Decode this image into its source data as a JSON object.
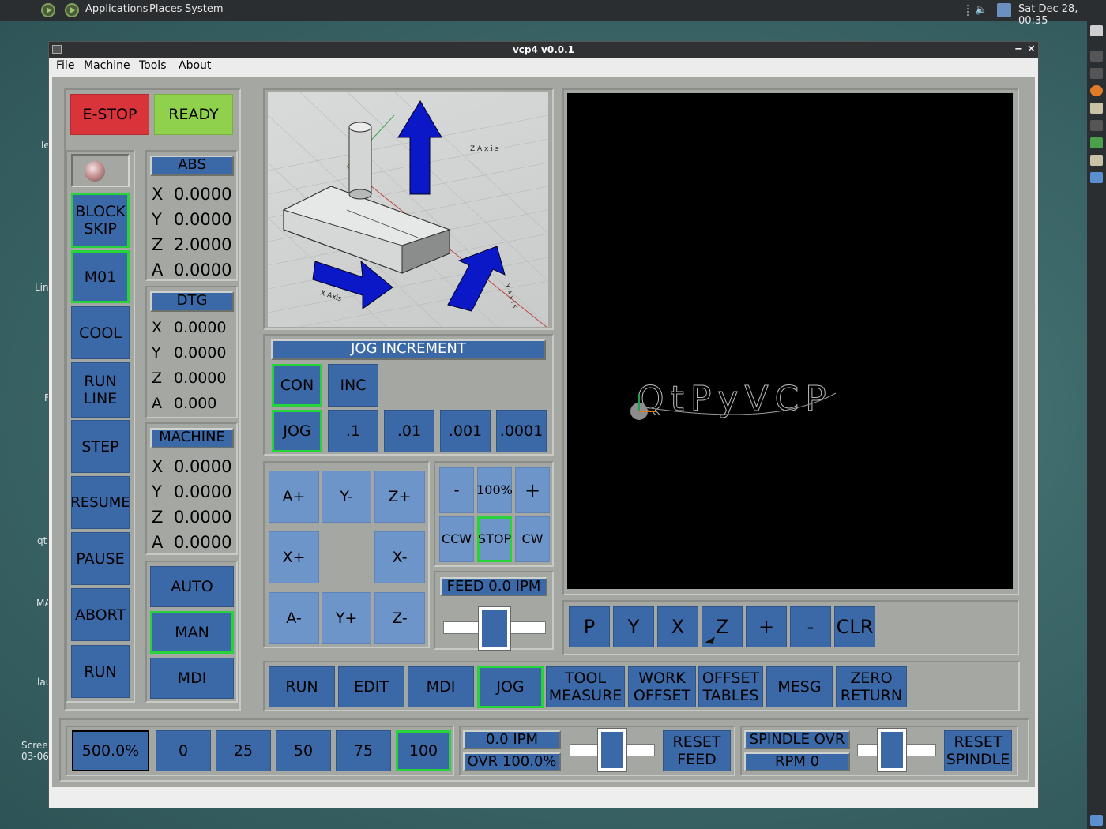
{
  "desktop": {
    "top_menu": [
      "Applications",
      "Places",
      "System"
    ],
    "clock": "Sat Dec 28, 00:35",
    "side_labels": [
      "le",
      "Lin",
      "F",
      "qt",
      "MA",
      "lau",
      "Scree",
      "03-06"
    ]
  },
  "window": {
    "title": "vcp4 v0.0.1",
    "menus": [
      "File",
      "Machine",
      "Tools",
      "About"
    ]
  },
  "controls": {
    "estop": "E-STOP",
    "ready": "READY"
  },
  "left_buttons": [
    "BLOCK\nSKIP",
    "M01",
    "COOL",
    "RUN\nLINE",
    "STEP",
    "RESUME",
    "PAUSE",
    "ABORT",
    "RUN"
  ],
  "dro": {
    "abs": {
      "title": "ABS",
      "rows": [
        [
          "X",
          "0.0000"
        ],
        [
          "Y",
          "0.0000"
        ],
        [
          "Z",
          "2.0000"
        ],
        [
          "A",
          "0.0000"
        ]
      ]
    },
    "dtg": {
      "title": "DTG",
      "rows": [
        [
          "X",
          "0.0000"
        ],
        [
          "Y",
          "0.0000"
        ],
        [
          "Z",
          "0.0000"
        ],
        [
          "A",
          "0.000"
        ]
      ]
    },
    "machine": {
      "title": "MACHINE",
      "rows": [
        [
          "X",
          "0.0000"
        ],
        [
          "Y",
          "0.0000"
        ],
        [
          "Z",
          "0.0000"
        ],
        [
          "A",
          "0.0000"
        ]
      ]
    }
  },
  "modes": [
    "AUTO",
    "MAN",
    "MDI"
  ],
  "model_labels": {
    "z_axis": "Z A x i s",
    "x_axis": "X Axis",
    "y_axis": "Y A x i s"
  },
  "jog": {
    "title": "JOG INCREMENT",
    "con": "CON",
    "inc": "INC",
    "jog": "JOG",
    "increments": [
      ".1",
      ".01",
      ".001",
      ".0001"
    ],
    "axis_buttons": [
      "A+",
      "Y-",
      "Z+",
      "X+",
      "X-",
      "A-",
      "Y+",
      "Z-"
    ]
  },
  "spindle": {
    "minus": "-",
    "pct": "100%",
    "plus": "+",
    "ccw": "CCW",
    "stop": "STOP",
    "cw": "CW"
  },
  "feed": {
    "label": "FEED 0.0  IPM",
    "slider_level": 0.5
  },
  "preview": {
    "logo": "QtPyVCP",
    "view_buttons": [
      "P",
      "Y",
      "X",
      "Z",
      "+",
      "-",
      "CLR"
    ]
  },
  "nav_tabs": [
    "RUN",
    "EDIT",
    "MDI",
    "JOG",
    "TOOL\nMEASURE",
    "WORK\nOFFSET",
    "OFFSET\nTABLES",
    "MESG",
    "ZERO\nRETURN"
  ],
  "bottom": {
    "rapid_display": "500.0%",
    "rapid_buttons": [
      "0",
      "25",
      "50",
      "75",
      "100"
    ],
    "feed_ipm": "0.0  IPM",
    "feed_ovr": "OVR 100.0%",
    "reset_feed": "RESET\nFEED",
    "spindle_ovr": "SPINDLE OVR",
    "rpm": "RPM 0",
    "reset_spindle": "RESET\nSPINDLE"
  },
  "colors": {
    "button_blue": "#3b69a8",
    "active_green": "#27d33a",
    "estop_red": "#d8343a",
    "ready_green": "#8fd04d"
  }
}
